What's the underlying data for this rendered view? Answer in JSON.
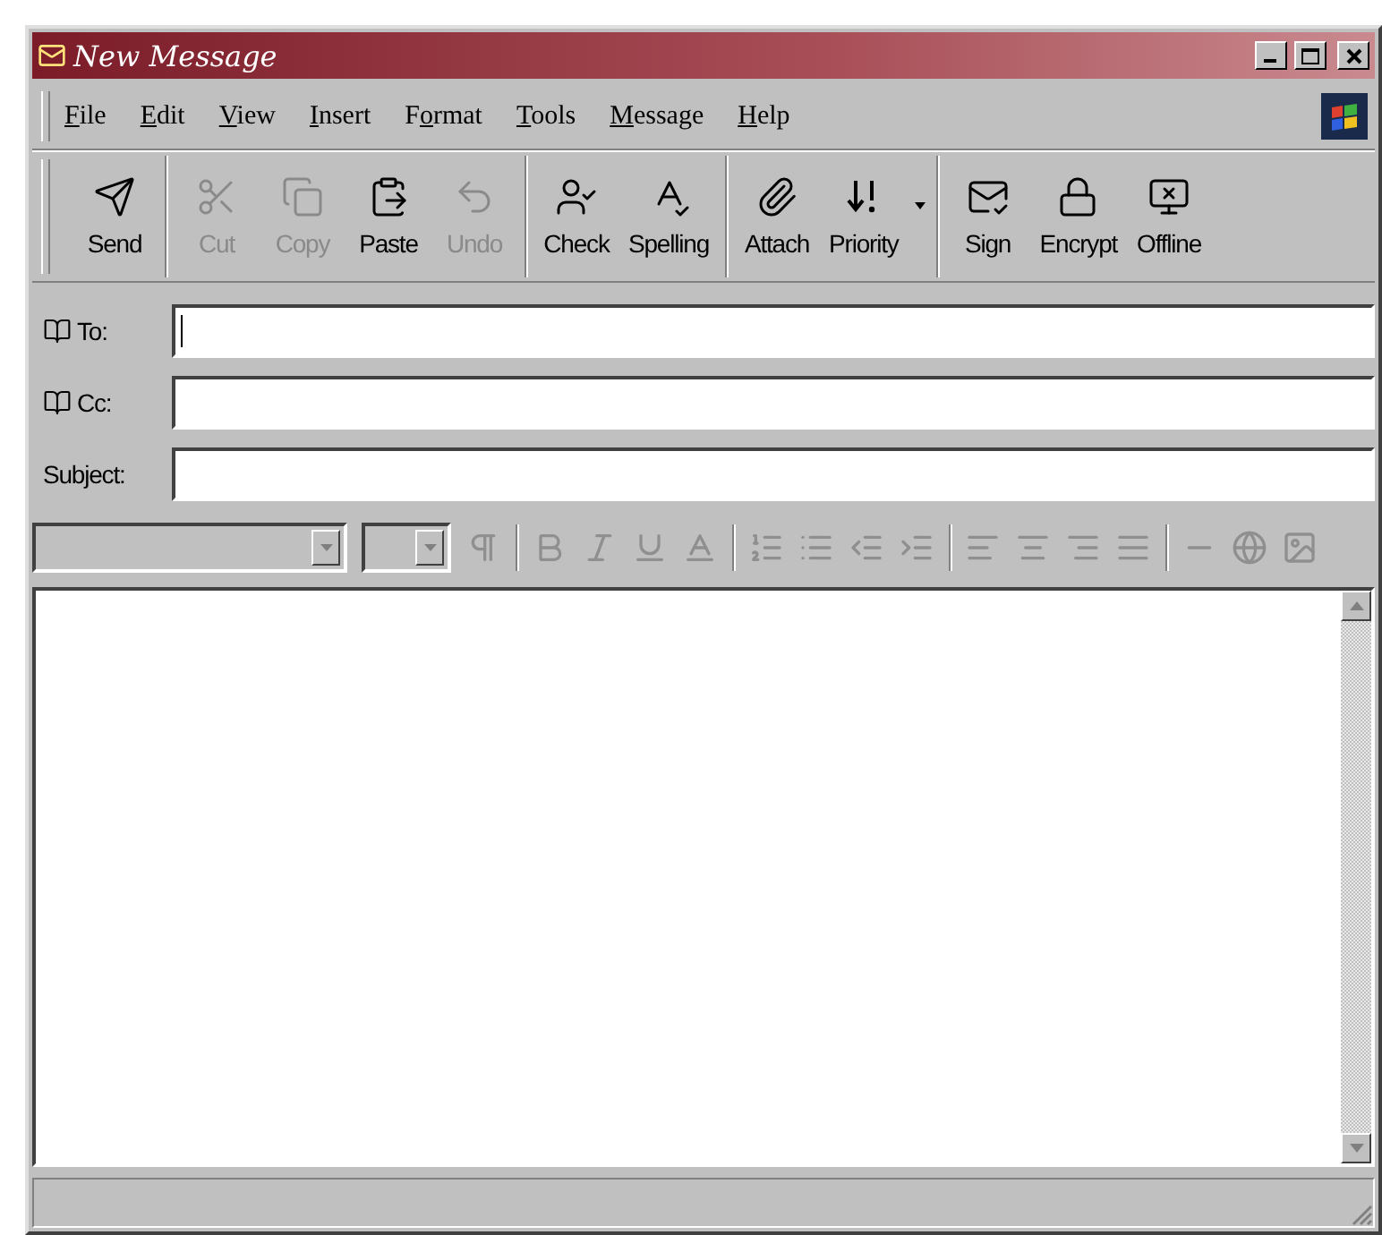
{
  "window": {
    "title": "New Message"
  },
  "menu": [
    {
      "accel": "F",
      "after": "ile"
    },
    {
      "accel": "E",
      "after": "dit"
    },
    {
      "accel": "V",
      "after": "iew"
    },
    {
      "accel": "I",
      "after": "nsert"
    },
    {
      "before": "F",
      "accel": "o",
      "after": "rmat"
    },
    {
      "accel": "T",
      "after": "ools"
    },
    {
      "accel": "M",
      "after": "essage"
    },
    {
      "accel": "H",
      "after": "elp"
    }
  ],
  "toolbar": {
    "groups": [
      [
        {
          "label": "Send",
          "disabled": false
        }
      ],
      [
        {
          "label": "Cut",
          "disabled": true
        },
        {
          "label": "Copy",
          "disabled": true
        },
        {
          "label": "Paste",
          "disabled": false
        },
        {
          "label": "Undo",
          "disabled": true
        }
      ],
      [
        {
          "label": "Check",
          "disabled": false
        },
        {
          "label": "Spelling",
          "disabled": false
        }
      ],
      [
        {
          "label": "Attach",
          "disabled": false
        },
        {
          "label": "Priority",
          "disabled": false,
          "has_menu": true
        }
      ],
      [
        {
          "label": "Sign",
          "disabled": false
        },
        {
          "label": "Encrypt",
          "disabled": false
        },
        {
          "label": "Offline",
          "disabled": false
        }
      ]
    ]
  },
  "fields": [
    {
      "label": "To:",
      "address_book": true,
      "focused": true
    },
    {
      "label": "Cc:",
      "address_book": true,
      "focused": false
    },
    {
      "label": "Subject:",
      "address_book": false,
      "focused": false
    }
  ],
  "format_bar": {
    "disabled": true
  }
}
